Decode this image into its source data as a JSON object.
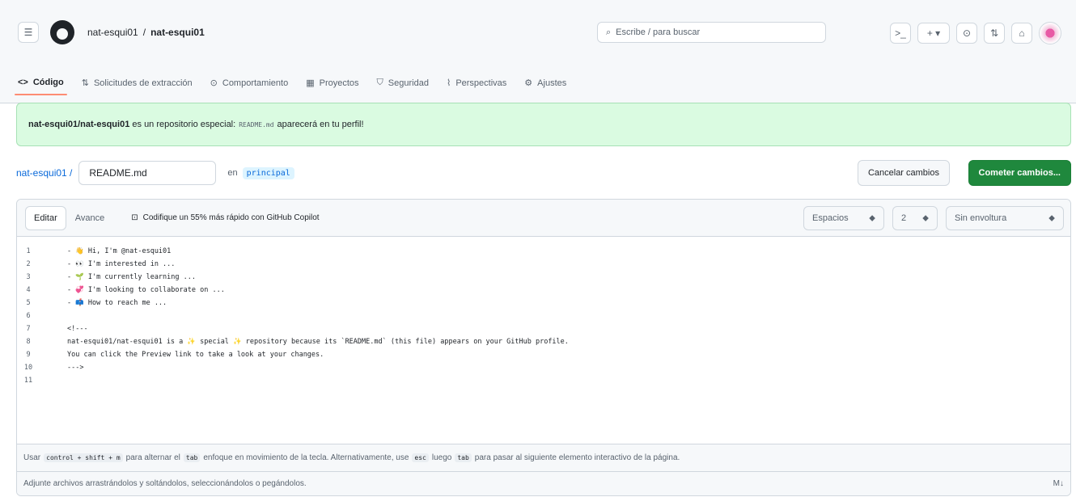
{
  "repo": {
    "owner": "nat-esqui01",
    "separator": "/",
    "name": "nat-esqui01"
  },
  "search": {
    "placeholder": "Escribe / para buscar"
  },
  "header_buttons": {
    "terminal": ">_",
    "plus": "+ ▾",
    "issues": "⊙",
    "pulls": "⇅",
    "inbox": "⌂"
  },
  "tabs": [
    {
      "icon": "<>",
      "label": "Código"
    },
    {
      "icon": "⇅",
      "label": "Solicitudes de extracción"
    },
    {
      "icon": "⊙",
      "label": "Comportamiento"
    },
    {
      "icon": "▦",
      "label": "Proyectos"
    },
    {
      "icon": "⛉",
      "label": "Seguridad"
    },
    {
      "icon": "⌇",
      "label": "Perspectivas"
    },
    {
      "icon": "⚙",
      "label": "Ajustes"
    }
  ],
  "flash": {
    "repo": "nat-esqui01/nat-esqui01",
    "text1": "es un repositorio especial:",
    "kbd": "README.md",
    "text2": "aparecerá en tu perfil!"
  },
  "path": {
    "owner": "nat-esqui01 /",
    "filename": "README.md",
    "in_label": "en",
    "branch": "principal"
  },
  "actions": {
    "cancel": "Cancelar cambios",
    "commit": "Cometer cambios..."
  },
  "editor": {
    "tab_edit": "Editar",
    "tab_preview": "Avance",
    "copilot_icon": "⊡",
    "copilot": "Codifique un 55% más rápido con GitHub Copilot",
    "indent_mode": "Espacios",
    "indent_size": "2",
    "wrap_mode": "Sin envoltura",
    "lines": [
      {
        "n": "1",
        "t": "- 👋 Hi, I'm @nat-esqui01"
      },
      {
        "n": "2",
        "t": "- 👀 I'm interested in ..."
      },
      {
        "n": "3",
        "t": "- 🌱 I'm currently learning ..."
      },
      {
        "n": "4",
        "t": "- 💞️ I'm looking to collaborate on ..."
      },
      {
        "n": "5",
        "t": "- 📫 How to reach me ..."
      },
      {
        "n": "6",
        "t": ""
      },
      {
        "n": "7",
        "t": "<!---"
      },
      {
        "n": "8",
        "t": "nat-esqui01/nat-esqui01 is a ✨ special ✨ repository because its `README.md` (this file) appears on your GitHub profile."
      },
      {
        "n": "9",
        "t": "You can click the Preview link to take a look at your changes."
      },
      {
        "n": "10",
        "t": "--->"
      },
      {
        "n": "11",
        "t": ""
      }
    ]
  },
  "footer": {
    "p1": "Usar",
    "k1": "control + shift + m",
    "p2": "para alternar el",
    "k2": "tab",
    "p3": "enfoque en movimiento de la tecla. Alternativamente, use",
    "k3": "esc",
    "p4": "luego",
    "k4": "tab",
    "p5": "para pasar al siguiente elemento interactivo de la página.",
    "attach": "Adjunte archivos arrastrándolos y soltándolos, seleccionándolos o pegándolos.",
    "md_icon": "M↓"
  }
}
